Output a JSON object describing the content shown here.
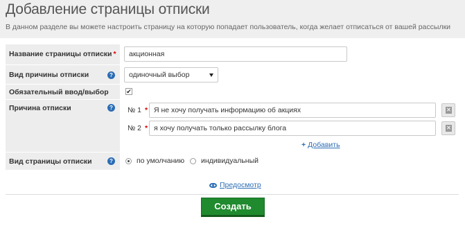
{
  "header": {
    "title": "Добавление страницы отписки",
    "description": "В данном разделе вы можете настроить страницу на которую попадает пользователь, когда желает отписаться от вашей рассылки"
  },
  "form": {
    "name": {
      "label": "Название страницы отписки",
      "required_mark": "*",
      "value": "акционная"
    },
    "reason_type": {
      "label": "Вид причины отписки",
      "help": "?",
      "selected": "одиночный выбор"
    },
    "mandatory": {
      "label": "Обязательный ввод/выбор",
      "checked": true,
      "check_mark": "✔"
    },
    "reasons": {
      "label": "Причина отписки",
      "help": "?",
      "items": [
        {
          "num": "№ 1",
          "required_mark": "*",
          "value": "Я не хочу получать информацию об акциях"
        },
        {
          "num": "№ 2",
          "required_mark": "*",
          "value": "я хочу получать только рассылку блога"
        }
      ],
      "add_label": "Добавить",
      "add_icon": "+"
    },
    "page_type": {
      "label": "Вид страницы отписки",
      "help": "?",
      "options": [
        {
          "label": "по умолчанию",
          "checked": true
        },
        {
          "label": "индивидуальный",
          "checked": false
        }
      ]
    }
  },
  "preview_label": "Предосмотр",
  "submit_label": "Создать",
  "colors": {
    "accent": "#2c6db5",
    "submit": "#1f8a2e",
    "label_bg": "#ededed"
  }
}
